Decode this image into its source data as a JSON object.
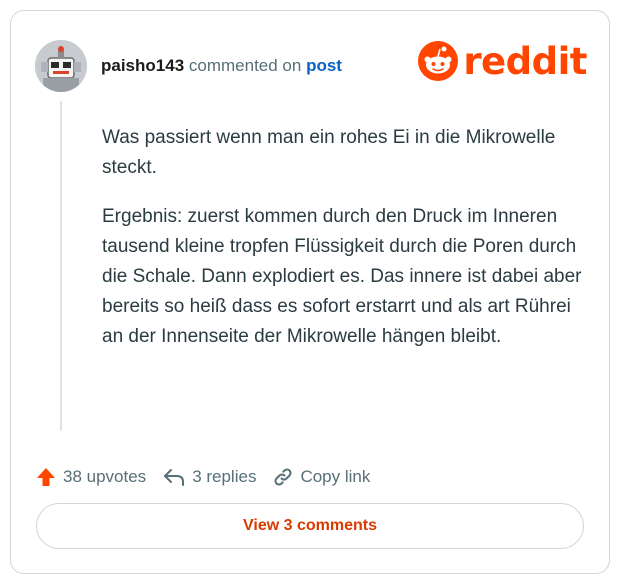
{
  "comment": {
    "username": "paisho143",
    "commented_on_text": "commented on",
    "post_link": "post",
    "paragraphs": [
      "Was passiert wenn man ein rohes Ei in die Mikrowelle steckt.",
      "Ergebnis: zuerst kommen durch den Druck im Inneren tausend kleine tropfen Flüssigkeit durch die Poren durch die Schale. Dann explodiert es. Das innere ist dabei aber bereits so heiß dass es sofort erstarrt und als art Rührei an der Innenseite der Mikrowelle hängen bleibt."
    ]
  },
  "brand": {
    "logo_text": "reddit",
    "color": "#ff4500"
  },
  "actions": {
    "upvotes": "38 upvotes",
    "replies": "3 replies",
    "copy_link": "Copy link"
  },
  "footer": {
    "view_comments": "View 3 comments"
  },
  "colors": {
    "upvote": "#ff4500",
    "link": "#0a62c8",
    "button_text": "#d93a00"
  },
  "icons": [
    "avatar-robot",
    "reddit-snoo-icon",
    "upvote-arrow-icon",
    "reply-icon",
    "link-icon"
  ]
}
